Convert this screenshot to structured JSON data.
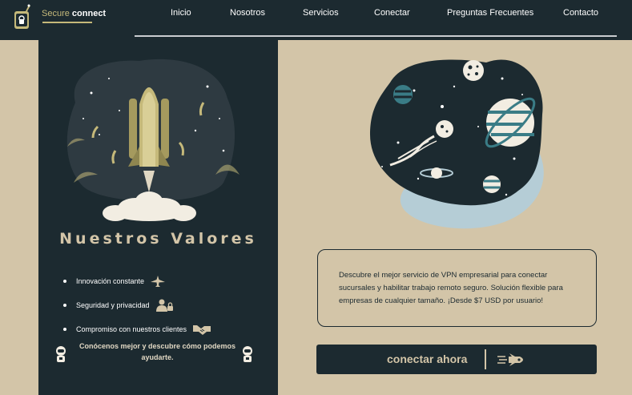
{
  "header": {
    "brand_first": "Secure",
    "brand_second": "connect",
    "nav": [
      "Inicio",
      "Nosotros",
      "Servicios",
      "Conectar",
      "Preguntas Frecuentes",
      "Contacto"
    ]
  },
  "values": {
    "title": "Nuestros Valores",
    "items": [
      {
        "label": "Innovación constante",
        "icon": "plane-icon"
      },
      {
        "label": "Seguridad y privacidad",
        "icon": "user-lock-icon"
      },
      {
        "label": "Compromiso con nuestros clientes",
        "icon": "handshake-icon"
      }
    ],
    "cta": "Conócenos mejor y descubre cómo podemos ayudarte."
  },
  "info": {
    "text": "Descubre el mejor servicio de VPN empresarial para conectar sucursales y habilitar trabajo remoto seguro. Solución flexible para empresas de cualquier tamaño. ¡Desde $7 USD por usuario!"
  },
  "cta_button": {
    "label": "conectar ahora",
    "icon": "rocket-icon"
  },
  "colors": {
    "dark": "#1c2a30",
    "beige": "#d3c5a8",
    "gold": "#c5b97a",
    "teal": "#3a7c86",
    "light_blue": "#b5cdd6"
  }
}
